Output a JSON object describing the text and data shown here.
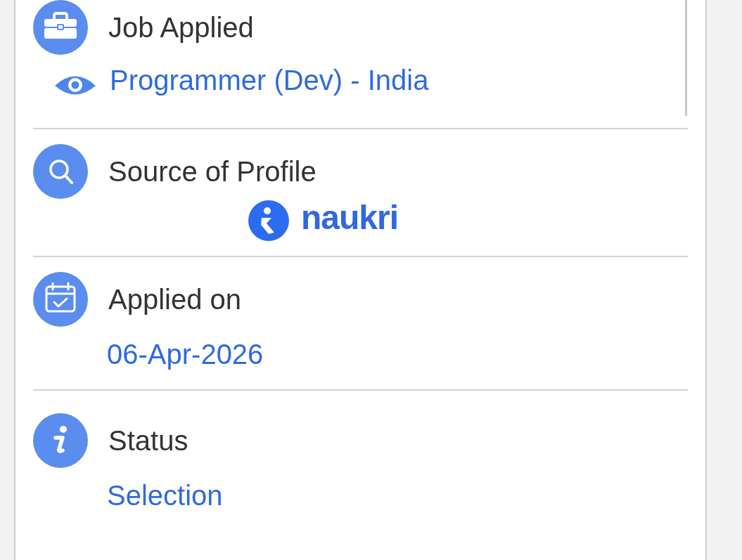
{
  "sections": [
    {
      "title": "Job Applied",
      "value": {
        "kind": "link",
        "text": "Programmer (Dev) - India"
      }
    },
    {
      "title": "Source of Profile",
      "value": {
        "kind": "logo",
        "text": "naukri"
      }
    },
    {
      "title": "Applied on",
      "value": {
        "kind": "text",
        "text": "06-Apr-2026"
      }
    },
    {
      "title": "Status",
      "value": {
        "kind": "text",
        "text": "Selection"
      }
    }
  ]
}
